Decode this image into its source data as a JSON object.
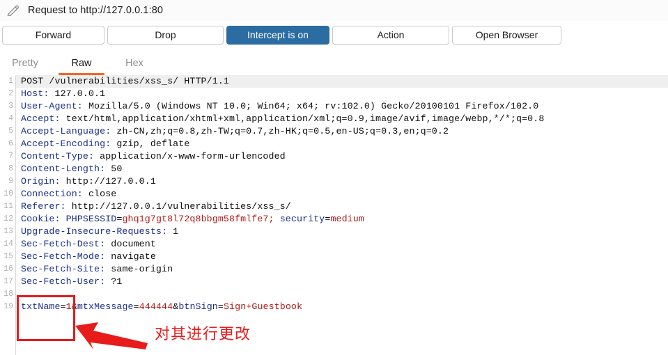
{
  "window": {
    "icon": "pencil-edit-icon",
    "title": "Request to http://127.0.0.1:80"
  },
  "toolbar": {
    "forward_label": "Forward",
    "drop_label": "Drop",
    "intercept_label": "Intercept is on",
    "action_label": "Action",
    "open_browser_label": "Open Browser",
    "intercept_active_color": "#2b6ca3"
  },
  "tabs": [
    {
      "label": "Pretty",
      "active": false
    },
    {
      "label": "Raw",
      "active": true
    },
    {
      "label": "Hex",
      "active": false
    }
  ],
  "tab_accent_color": "#f26627",
  "editor": {
    "highlighted_line": 1,
    "line_numbers": [
      1,
      2,
      3,
      4,
      5,
      6,
      7,
      8,
      9,
      10,
      11,
      12,
      13,
      14,
      15,
      16,
      17,
      18,
      19
    ],
    "colors": {
      "header_name": "#1b2f87",
      "header_value": "#0e0e0e",
      "param_name": "#1b2f87",
      "param_value": "#b01818",
      "line_number": "#b0b0b0",
      "highlight_background": "#efefef"
    },
    "lines": [
      {
        "n": 1,
        "request_line": "POST /vulnerabilities/xss_s/ HTTP/1.1"
      },
      {
        "n": 2,
        "name": "Host:",
        "value": " 127.0.0.1"
      },
      {
        "n": 3,
        "name": "User-Agent:",
        "value": " Mozilla/5.0 (Windows NT 10.0; Win64; x64; rv:102.0) Gecko/20100101 Firefox/102.0"
      },
      {
        "n": 4,
        "name": "Accept:",
        "value": " text/html,application/xhtml+xml,application/xml;q=0.9,image/avif,image/webp,*/*;q=0.8"
      },
      {
        "n": 5,
        "name": "Accept-Language:",
        "value": " zh-CN,zh;q=0.8,zh-TW;q=0.7,zh-HK;q=0.5,en-US;q=0.3,en;q=0.2"
      },
      {
        "n": 6,
        "name": "Accept-Encoding:",
        "value": " gzip, deflate"
      },
      {
        "n": 7,
        "name": "Content-Type:",
        "value": " application/x-www-form-urlencoded"
      },
      {
        "n": 8,
        "name": "Content-Length:",
        "value": " 50"
      },
      {
        "n": 9,
        "name": "Origin:",
        "value": " http://127.0.0.1"
      },
      {
        "n": 10,
        "name": "Connection:",
        "value": " close"
      },
      {
        "n": 11,
        "name": "Referer:",
        "value": " http://127.0.0.1/vulnerabilities/xss_s/"
      },
      {
        "n": 12,
        "name": "Cookie:",
        "cookie": {
          "name1": "PHPSESSID",
          "value1": "ghq1g7gt8l72q8bbgm58fmlfe7;",
          "name2": " security",
          "value2": "medium"
        }
      },
      {
        "n": 13,
        "name": "Upgrade-Insecure-Requests:",
        "value": " 1"
      },
      {
        "n": 14,
        "name": "Sec-Fetch-Dest:",
        "value": " document"
      },
      {
        "n": 15,
        "name": "Sec-Fetch-Mode:",
        "value": " navigate"
      },
      {
        "n": 16,
        "name": "Sec-Fetch-Site:",
        "value": " same-origin"
      },
      {
        "n": 17,
        "name": "Sec-Fetch-User:",
        "value": " ?1"
      },
      {
        "n": 18,
        "blank": ""
      },
      {
        "n": 19,
        "body": {
          "p1": "txtName",
          "v1": "1",
          "p2": "mtxMessage",
          "v2": "444444",
          "p3": "btnSign",
          "v3": "Sign+Guestbook"
        }
      }
    ]
  },
  "annotations": {
    "highlight_box_target": "txtName=1",
    "arrow": "arrow-pointing-left",
    "note_text": "对其进行更改",
    "note_color": "#e81b1b"
  }
}
